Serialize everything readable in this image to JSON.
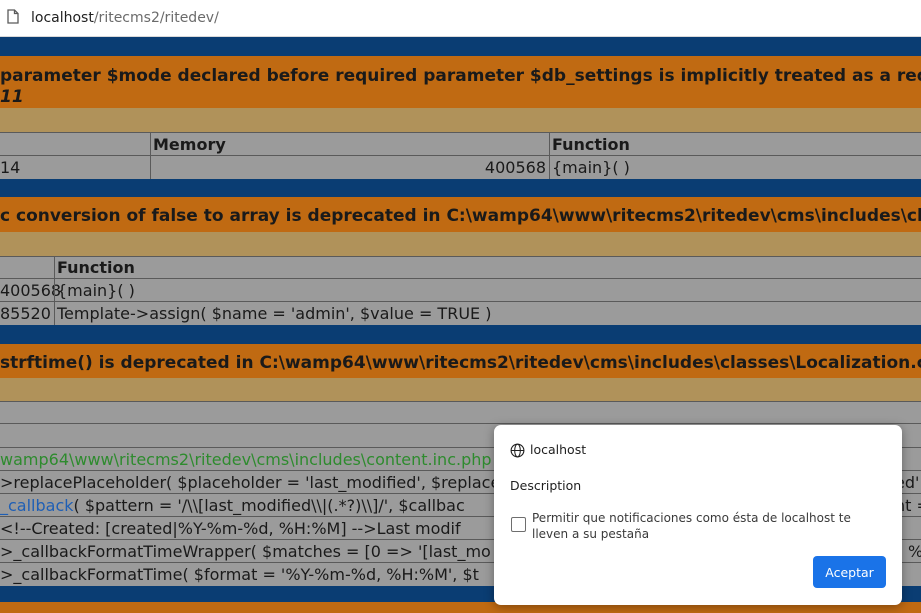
{
  "browser": {
    "url_host": "localhost",
    "url_path": "/ritecms2/ritedev/"
  },
  "error1": {
    "message": "parameter $mode declared before required parameter $db_settings is implicitly treated as a required p",
    "line": "11",
    "headers": {
      "memory": "Memory",
      "function": "Function"
    },
    "row": {
      "time": "14",
      "memory": "400568",
      "function": "{main}( )"
    }
  },
  "error2": {
    "message": "c conversion of false to array is deprecated in C:\\wamp64\\www\\ritecms2\\ritedev\\cms\\includes\\class",
    "headers": {
      "function": "Function"
    },
    "rows": [
      {
        "memory": "400568",
        "function": "{main}( )"
      },
      {
        "memory": "85520",
        "function": "Template->assign( $name = 'admin', $value = TRUE )"
      }
    ]
  },
  "error3": {
    "message": "strftime() is deprecated in C:\\wamp64\\www\\ritecms2\\ritedev\\cms\\includes\\classes\\Localization.cla",
    "lines": [
      {
        "green": "wamp64\\www\\ritecms2\\ritedev\\cms\\includes\\content.inc.php",
        "text": ""
      },
      {
        "prefix": "",
        "text": ">replacePlaceholder( $placeholder = 'last_modified', $replace",
        "right": "ed'"
      },
      {
        "blue": "_callback",
        "text": "( $pattern = '/\\\\[last_modified\\\\|(.*?)\\\\]/', $callbac",
        "right": "nt ="
      },
      {
        "text": "<!--Created: [created|%Y-%m-%d, %H:%M] -->Last modif"
      },
      {
        "text": ">_callbackFormatTimeWrapper( $matches = [0 => '[last_mo",
        "right": "%"
      },
      {
        "text": ">_callbackFormatTime( $format = '%Y-%m-%d, %H:%M', $t"
      }
    ]
  },
  "popup": {
    "host": "localhost",
    "description": "Description",
    "checkbox_label": "Permitir que notificaciones como ésta de localhost te lleven a su pestaña",
    "accept_label": "Aceptar"
  }
}
